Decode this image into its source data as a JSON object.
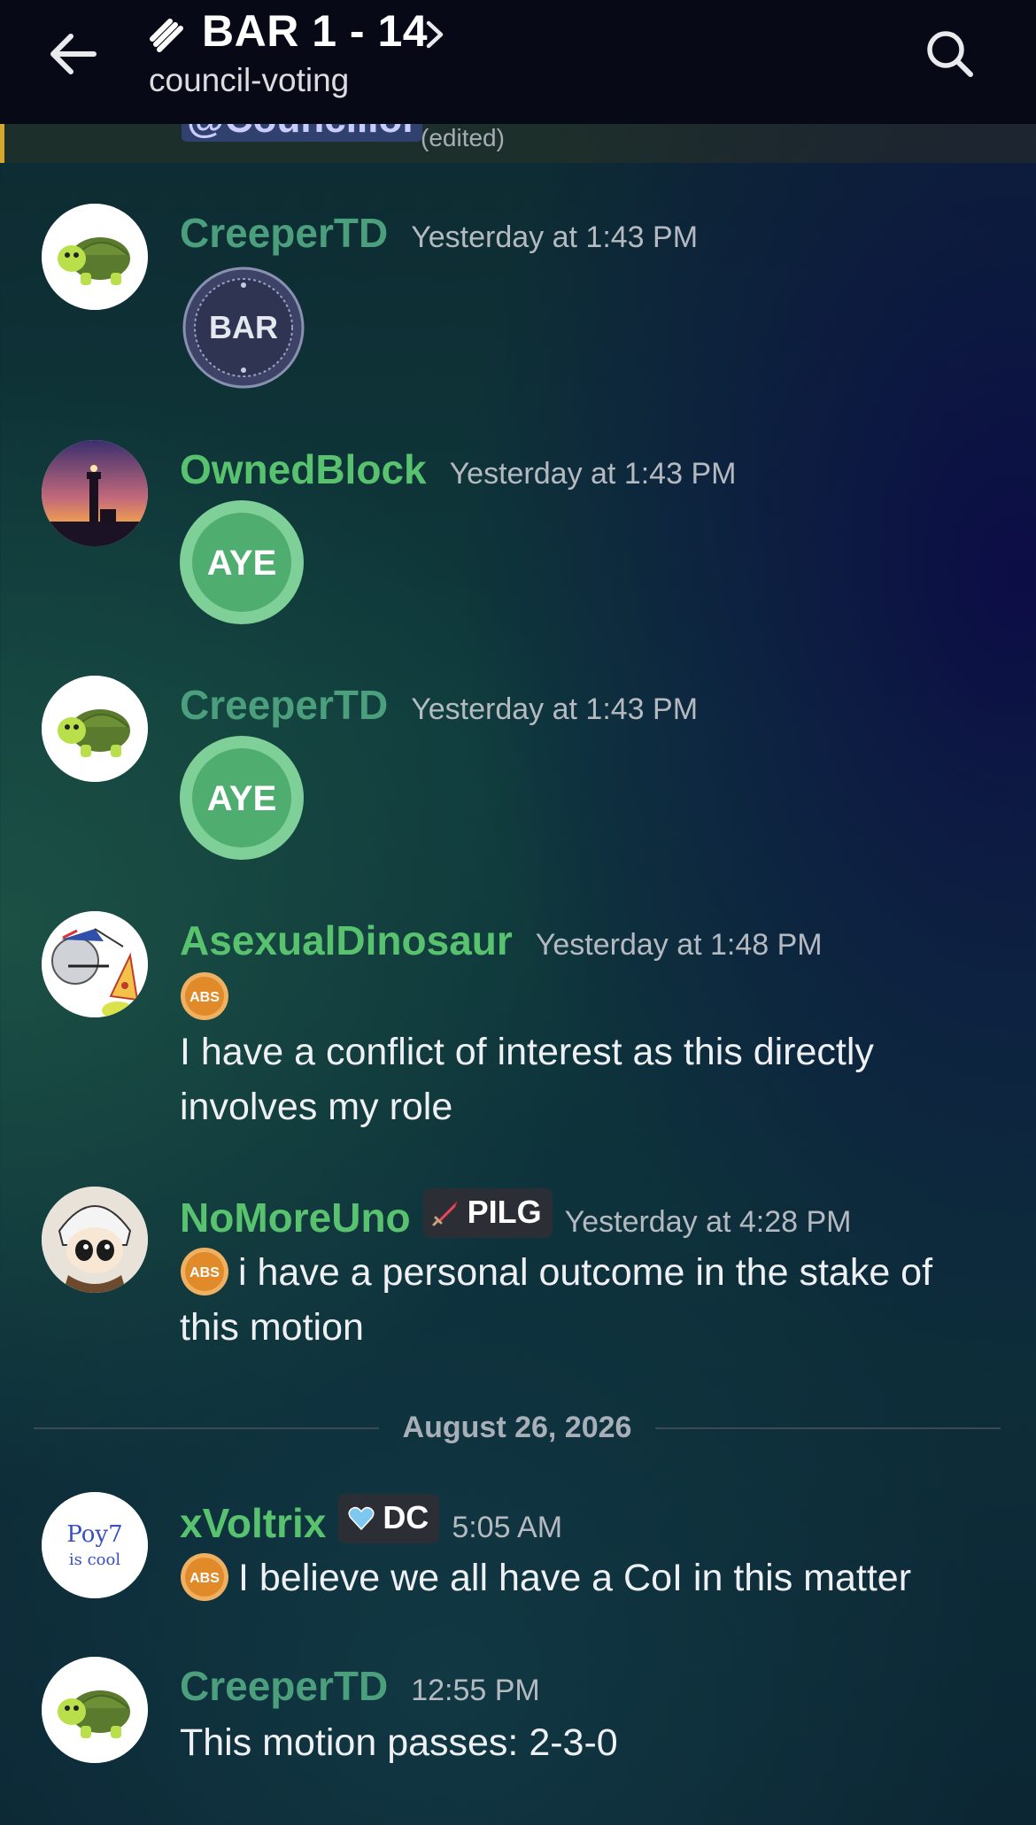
{
  "header": {
    "channel_name": "BAR 1 - 14",
    "sub_name": "council-voting"
  },
  "previous_message": {
    "mention": "@Councillor",
    "edited": "(edited)"
  },
  "date_divider": "August 26, 2026",
  "messages": [
    {
      "author": "CreeperTD",
      "timestamp": "Yesterday at 1:43 PM",
      "sticker": "BAR",
      "avatar": "turtle-avatar"
    },
    {
      "author": "OwnedBlock",
      "timestamp": "Yesterday at 1:43 PM",
      "sticker": "AYE",
      "avatar": "lighthouse-avatar"
    },
    {
      "author": "CreeperTD",
      "timestamp": "Yesterday at 1:43 PM",
      "sticker": "AYE",
      "avatar": "turtle-avatar"
    },
    {
      "author": "AsexualDinosaur",
      "timestamp": "Yesterday at 1:48 PM",
      "badge": "ABS",
      "text": "I have a conflict of interest as this directly involves my role",
      "avatar": "dinosaur-avatar"
    },
    {
      "author": "NoMoreUno",
      "tag": "PILG",
      "tag_icon": "sword-icon",
      "timestamp": "Yesterday at 4:28 PM",
      "badge": "ABS",
      "text": "i have a personal outcome in the stake of this motion",
      "avatar": "anime-avatar"
    },
    {
      "author": "xVoltrix",
      "tag": "DC",
      "tag_icon": "heart-icon",
      "timestamp": "5:05 AM",
      "badge": "ABS",
      "text": "I believe we all have a CoI in this matter",
      "avatar": "sketch-avatar",
      "avatar_text": [
        "Poy7",
        "is cool"
      ]
    },
    {
      "author": "CreeperTD",
      "timestamp": "12:55 PM",
      "text": "This motion passes: 2-3-0",
      "avatar": "turtle-avatar"
    }
  ],
  "colors": {
    "username_green": "#58c26f",
    "username_creeper": "#4c9f7d",
    "aye_green": "#5cb87a",
    "abs_orange": "#e8952f"
  }
}
